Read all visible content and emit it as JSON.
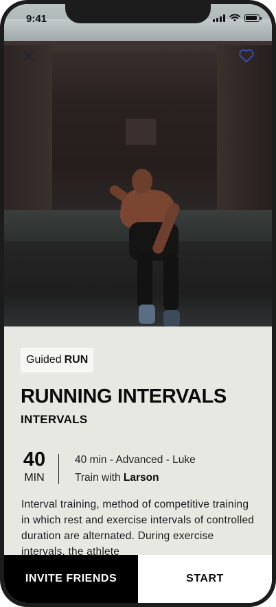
{
  "status_bar": {
    "time": "9:41"
  },
  "hero": {
    "image": "runner-sprint-photo"
  },
  "icons": {
    "close": "close-icon",
    "favorite": "heart-icon"
  },
  "workout": {
    "category_prefix": "Guided",
    "category": "RUN",
    "title": "RUNNING INTERVALS",
    "subtitle": "INTERVALS",
    "duration_value": "40",
    "duration_unit": "MIN",
    "meta": "40 min - Advanced - Luke",
    "trainer_prefix": "Train with",
    "trainer_name": "Larson",
    "description": "Interval training, method of competitive training in which rest and exercise intervals of controlled duration are alternated. During exercise intervals, the athlete"
  },
  "actions": {
    "invite_label": "INVITE FRIENDS",
    "start_label": "START"
  },
  "colors": {
    "background": "#e8e8e3",
    "primary_button": "#000000",
    "secondary_button": "#ffffff",
    "heart": "#3a4fc4"
  }
}
